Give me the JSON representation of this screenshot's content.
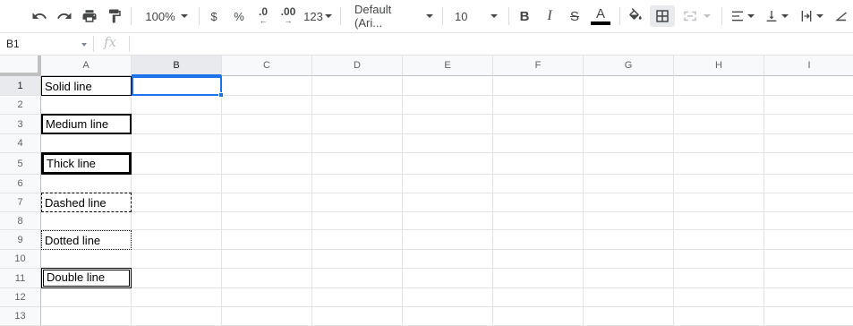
{
  "toolbar": {
    "zoom": "100%",
    "currency": "$",
    "percent": "%",
    "decrease_decimal": ".0",
    "increase_decimal": ".00",
    "more_formats": "123",
    "font_family": "Default (Ari...",
    "font_size": "10",
    "bold": "B",
    "italic": "I",
    "strikethrough": "S",
    "text_color": "A",
    "text_color_value": "#000000"
  },
  "formula_bar": {
    "cell_reference": "B1",
    "fx": "fx",
    "content": ""
  },
  "sheet": {
    "columns": [
      "A",
      "B",
      "C",
      "D",
      "E",
      "F",
      "G",
      "H",
      "I"
    ],
    "rows": [
      "1",
      "2",
      "3",
      "4",
      "5",
      "6",
      "7",
      "8",
      "9",
      "10",
      "11",
      "12",
      "13"
    ],
    "selected_cell": "B1",
    "cells": {
      "A1": "Solid line",
      "A3": "Medium line",
      "A5": "Thick line",
      "A7": "Dashed line",
      "A9": "Dotted line",
      "A11": "Double line"
    },
    "accent_color": "#1a73e8"
  }
}
